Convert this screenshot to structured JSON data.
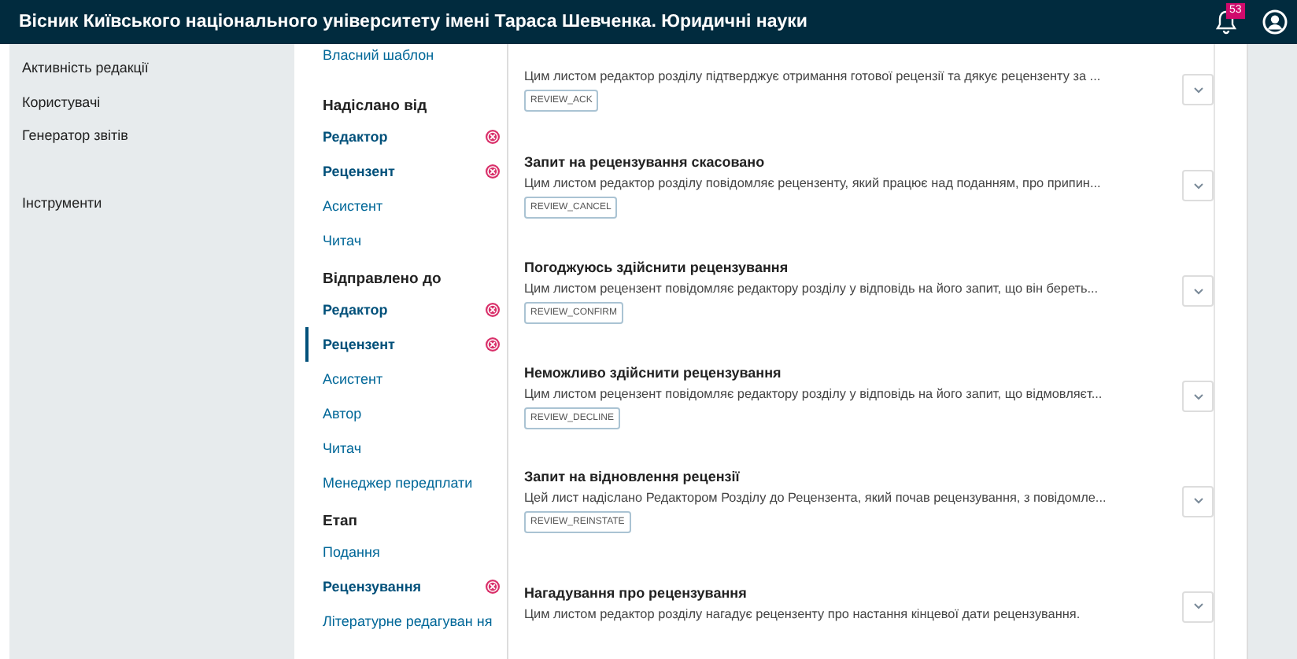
{
  "header": {
    "title": "Вісник Київського національного університету імені Тараса Шевченка. Юридичні науки",
    "notifications_badge": "53"
  },
  "sidebar": {
    "items": [
      {
        "label": "Активність редакції"
      },
      {
        "label": "Користувачі"
      },
      {
        "label": "Генератор звітів"
      },
      {
        "label": "Інструменти",
        "kind": "section"
      }
    ]
  },
  "filters": {
    "top_item": "Власний шаблон",
    "groups": [
      {
        "heading": "Надіслано від",
        "items": [
          {
            "label": "Редактор",
            "selected": true,
            "focused": false
          },
          {
            "label": "Рецензент",
            "selected": true,
            "focused": false
          },
          {
            "label": "Асистент",
            "selected": false,
            "focused": false
          },
          {
            "label": "Читач",
            "selected": false,
            "focused": false
          }
        ]
      },
      {
        "heading": "Відправлено до",
        "items": [
          {
            "label": "Редактор",
            "selected": true,
            "focused": false
          },
          {
            "label": "Рецензент",
            "selected": true,
            "focused": true
          },
          {
            "label": "Асистент",
            "selected": false,
            "focused": false
          },
          {
            "label": "Автор",
            "selected": false,
            "focused": false
          },
          {
            "label": "Читач",
            "selected": false,
            "focused": false
          },
          {
            "label": "Менеджер передплати",
            "selected": false,
            "focused": false
          }
        ]
      },
      {
        "heading": "Етап",
        "items": [
          {
            "label": "Подання",
            "selected": false,
            "focused": false
          },
          {
            "label": "Рецензування",
            "selected": true,
            "focused": false
          },
          {
            "label": "Літературне редагуван ня",
            "selected": false,
            "focused": false
          }
        ]
      }
    ]
  },
  "emails": [
    {
      "description": "Цим листом редактор розділу підтверджує отримання готової рецензії та дякує рецензенту за ...",
      "key": "REVIEW_ACK"
    },
    {
      "title": "Запит на рецензування скасовано",
      "description": "Цим листом редактор розділу повідомляє рецензенту, який працює над поданням, про припин...",
      "key": "REVIEW_CANCEL"
    },
    {
      "title": "Погоджуюсь здійснити рецензування",
      "description": "Цим листом рецензент повідомляє редактору розділу у відповідь на його запит, що він береть...",
      "key": "REVIEW_CONFIRM"
    },
    {
      "title": "Неможливо здійснити рецензування",
      "description": "Цим листом рецензент повідомляє редактору розділу у відповідь на його запит, що відмовляєт...",
      "key": "REVIEW_DECLINE"
    },
    {
      "title": "Запит на відновлення рецензії",
      "description": "Цей лист надіслано Редактором Розділу до Рецензента, який почав рецензування, з повідомле...",
      "key": "REVIEW_REINSTATE"
    },
    {
      "title": "Нагадування про рецензування",
      "description": "Цим листом редактор розділу нагадує рецензенту про настання кінцевої дати рецензування."
    }
  ]
}
